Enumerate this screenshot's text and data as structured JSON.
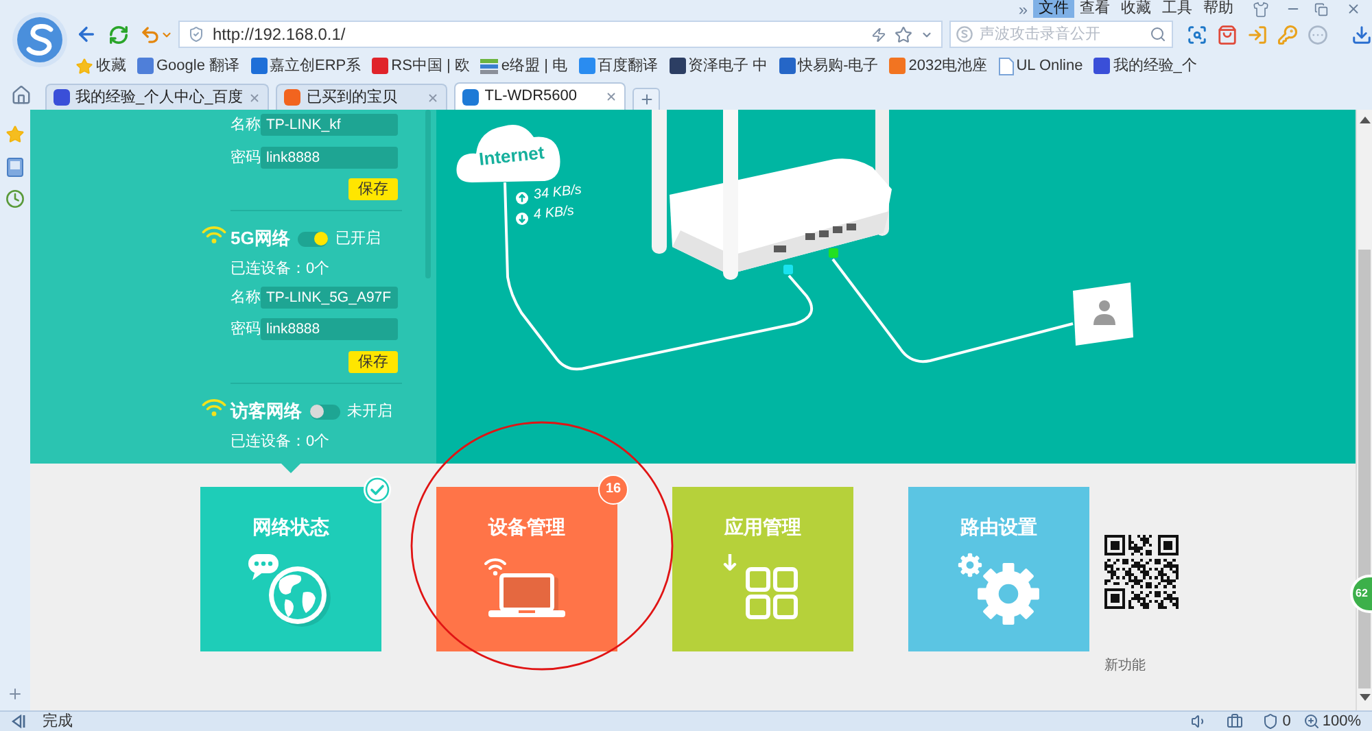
{
  "browser": {
    "menu_overflow": "»",
    "menu": [
      {
        "label": "文件",
        "selected": true
      },
      {
        "label": "查看",
        "selected": false
      },
      {
        "label": "收藏",
        "selected": false
      },
      {
        "label": "工具",
        "selected": false
      },
      {
        "label": "帮助",
        "selected": false
      }
    ],
    "address": "http://192.168.0.1/",
    "search": {
      "placeholder": "声波攻击录音公开"
    },
    "bookmarks": [
      {
        "label": "收藏",
        "kind": "star"
      },
      {
        "label": "Google 翻译",
        "kind": "tile",
        "color": "#4f7fd9"
      },
      {
        "label": "嘉立创ERP系",
        "kind": "tile",
        "color": "#1e6fd8"
      },
      {
        "label": "RS中国 | 欧",
        "kind": "tile",
        "color": "#e0242b"
      },
      {
        "label": "e络盟 | 电",
        "kind": "stack"
      },
      {
        "label": "百度翻译",
        "kind": "tile",
        "color": "#2a8cf0"
      },
      {
        "label": "资泽电子 中",
        "kind": "tile",
        "color": "#2c3e63"
      },
      {
        "label": "快易购-电子",
        "kind": "tile",
        "color": "#2566c7"
      },
      {
        "label": "2032电池座",
        "kind": "tile",
        "color": "#f27421"
      },
      {
        "label": "UL Online",
        "kind": "page"
      },
      {
        "label": "我的经验_个",
        "kind": "tile",
        "color": "#3a4fd8"
      }
    ],
    "tabs": [
      {
        "label": "我的经验_个人中心_百度",
        "selected": false,
        "color": "#3a4fd8"
      },
      {
        "label": "已买到的宝贝",
        "selected": false,
        "color": "#f2641f"
      },
      {
        "label": "TL-WDR5600",
        "selected": true,
        "color": "#1e7ad6"
      }
    ]
  },
  "panel": {
    "top_fields": [
      {
        "label": "名称",
        "value": "TP-LINK_kf"
      },
      {
        "label": "密码",
        "value": "link8888"
      }
    ],
    "top_save": "保存",
    "networks": [
      {
        "name": "5G网络",
        "on": true,
        "status": "已开启",
        "connected": "已连设备：0个",
        "fields": [
          {
            "label": "名称",
            "value": "TP-LINK_5G_A97F"
          },
          {
            "label": "密码",
            "value": "link8888"
          }
        ],
        "save": "保存"
      },
      {
        "name": "访客网络",
        "on": false,
        "status": "未开启",
        "connected": "已连设备：0个"
      }
    ]
  },
  "internet": {
    "label": "Internet",
    "upload": "34 KB/s",
    "download": "4 KB/s"
  },
  "tiles": [
    {
      "label": "网络状态",
      "kind": "globe",
      "color": "#1ecdb8",
      "selected": true,
      "checked": true
    },
    {
      "label": "设备管理",
      "kind": "laptop",
      "color": "#ff7448",
      "selected": false,
      "checked": false,
      "badge": "16"
    },
    {
      "label": "应用管理",
      "kind": "apps",
      "color": "#b6d13a",
      "selected": false,
      "checked": false
    },
    {
      "label": "路由设置",
      "kind": "gears",
      "color": "#5bc5e3",
      "selected": false,
      "checked": false
    }
  ],
  "qr": {
    "caption": "新功能"
  },
  "side_badge": "62",
  "status_bar": {
    "text": "完成",
    "shield_count": "0",
    "zoom": "100%"
  }
}
